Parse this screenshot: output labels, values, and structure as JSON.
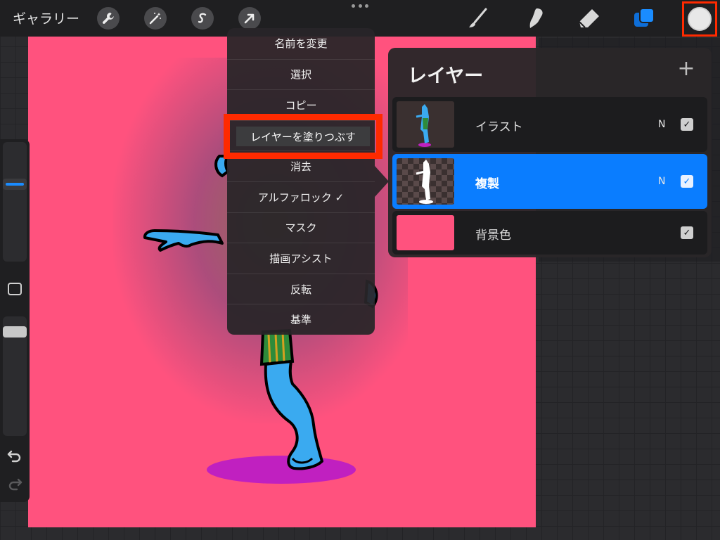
{
  "toolbar": {
    "gallery_label": "ギャラリー",
    "left_tools": [
      {
        "icon": "wrench-icon",
        "name": "actions"
      },
      {
        "icon": "magic-wand-icon",
        "name": "adjustments"
      },
      {
        "icon": "selection-s-icon",
        "name": "selection"
      },
      {
        "icon": "arrow-transform-icon",
        "name": "transform"
      }
    ],
    "right_tools": [
      {
        "icon": "brush-icon",
        "name": "paint"
      },
      {
        "icon": "smudge-icon",
        "name": "smudge"
      },
      {
        "icon": "eraser-icon",
        "name": "erase"
      },
      {
        "icon": "layers-icon",
        "name": "layers",
        "color": "#1a8cff"
      }
    ],
    "color_swatch": "#e8e8e8",
    "highlight_color": "#ff2a00"
  },
  "canvas": {
    "background_color": "#ff527e",
    "shadow_color": "#c020c0"
  },
  "context_menu": {
    "items": [
      "名前を変更",
      "選択",
      "コピー",
      "レイヤーを塗りつぶす",
      "消去",
      "アルファロック ✓",
      "マスク",
      "描画アシスト",
      "反転",
      "基準"
    ],
    "highlighted_index": 3
  },
  "layers_panel": {
    "title": "レイヤー",
    "add_icon": "+",
    "layers": [
      {
        "name": "イラスト",
        "blend": "N",
        "visible_mark": "✓",
        "active": false
      },
      {
        "name": "複製",
        "blend": "N",
        "visible_mark": "✓",
        "active": true
      },
      {
        "name": "背景色",
        "blend": "",
        "visible_mark": "✓",
        "active": false,
        "color": "#ff527e"
      }
    ]
  }
}
